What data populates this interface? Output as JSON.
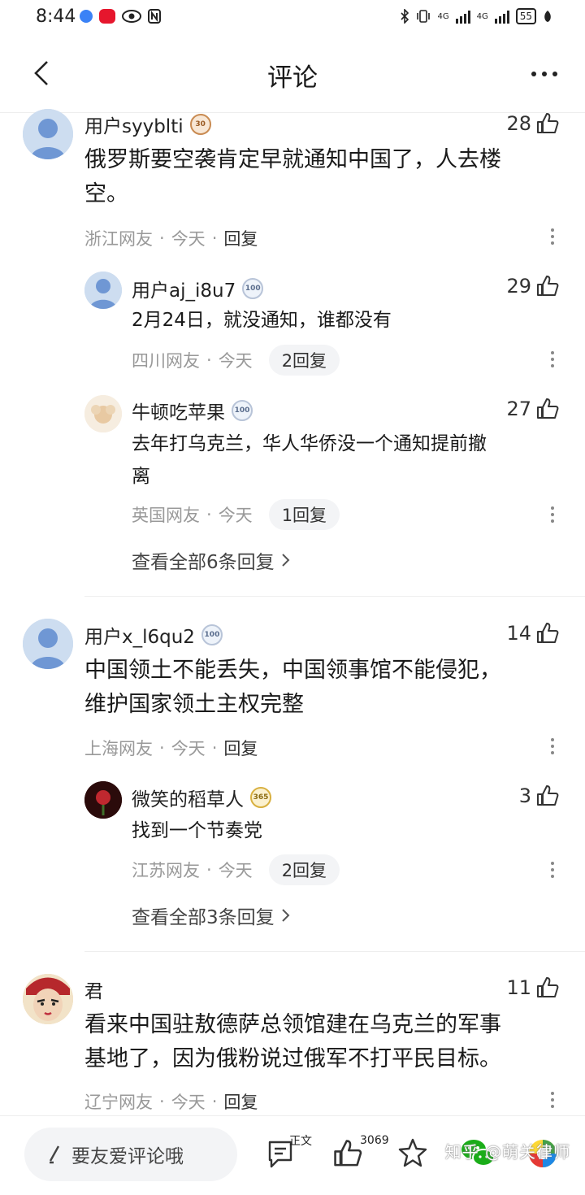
{
  "status_bar": {
    "time": "8:44",
    "battery": "55",
    "net1": "4G",
    "net2": "4G"
  },
  "header": {
    "title": "评论"
  },
  "comments": [
    {
      "user": "用户syyblti",
      "badge": "30",
      "likes": "28",
      "text_line1": "俄罗斯要空袭肯定早就通知中国了，人去楼",
      "text_line2": "空。",
      "location": "浙江网友",
      "time": "今天",
      "reply": "回复",
      "replies": [
        {
          "user": "用户aj_i8u7",
          "badge": "100",
          "likes": "29",
          "text": "2月24日，就没通知，谁都没有",
          "location": "四川网友",
          "time": "今天",
          "reply_count": "2回复"
        },
        {
          "user": "牛顿吃苹果",
          "badge": "100",
          "likes": "27",
          "text_line1": "去年打乌克兰，华人华侨没一个通知提前撤",
          "text_line2": "离",
          "location": "英国网友",
          "time": "今天",
          "reply_count": "1回复"
        }
      ],
      "view_all": "查看全部6条回复"
    },
    {
      "user": "用户x_l6qu2",
      "badge": "100",
      "likes": "14",
      "text_line1": "中国领土不能丢失，中国领事馆不能侵犯，",
      "text_line2": "维护国家领土主权完整",
      "location": "上海网友",
      "time": "今天",
      "reply": "回复",
      "replies": [
        {
          "user": "微笑的稻草人",
          "badge": "365",
          "likes": "3",
          "text": "找到一个节奏党",
          "location": "江苏网友",
          "time": "今天",
          "reply_count": "2回复"
        }
      ],
      "view_all": "查看全部3条回复"
    },
    {
      "user": "君",
      "likes": "11",
      "text_line1": "看来中国驻敖德萨总领馆建在乌克兰的军事",
      "text_line2": "基地了，因为俄粉说过俄军不打平民目标。",
      "location": "辽宁网友",
      "time": "今天",
      "reply": "回复"
    }
  ],
  "bottom_bar": {
    "input_placeholder": "要友爱评论哦",
    "doc_label": "正文",
    "like_count": "3069",
    "watermark": "知乎 @萌关律师"
  },
  "colors": {
    "text": "#1a1a1a",
    "meta": "#999999",
    "pill": "#f3f4f6"
  }
}
